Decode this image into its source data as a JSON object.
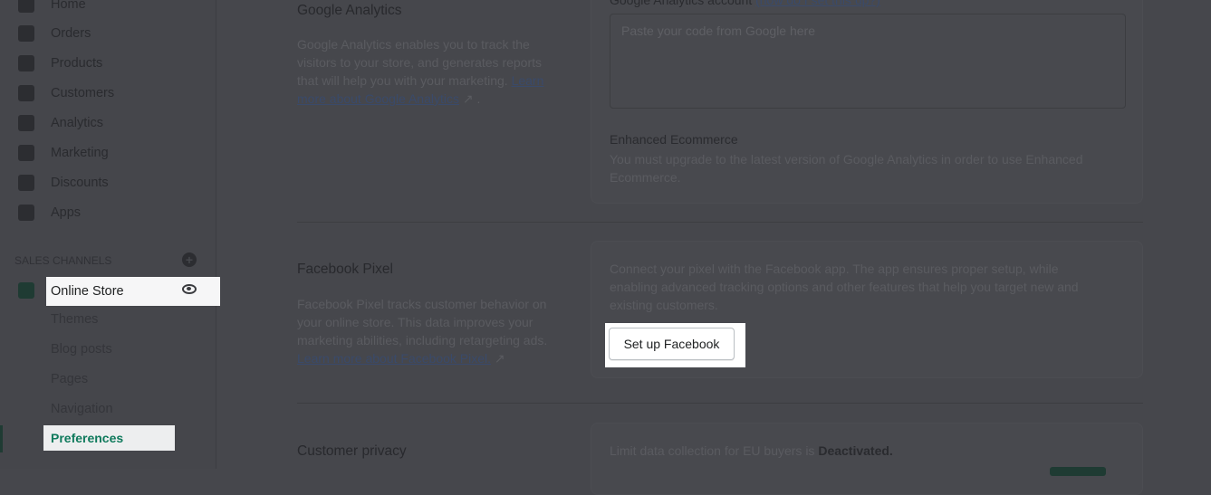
{
  "sidebar": {
    "items": [
      "Home",
      "Orders",
      "Products",
      "Customers",
      "Analytics",
      "Marketing",
      "Discounts",
      "Apps"
    ],
    "sales_channels": "SALES CHANNELS",
    "online_store": "Online Store",
    "sub_items": [
      "Themes",
      "Blog posts",
      "Pages",
      "Navigation"
    ],
    "active_sub": "Preferences"
  },
  "ga": {
    "title": "Google Analytics",
    "desc": "Google Analytics enables you to track the visitors to your store, and generates reports that will help you with your marketing.",
    "link": "Learn more about Google Analytics",
    "link_suffix": " .",
    "account_label": "Google Analytics account",
    "help_link": "(how do I set this up?)",
    "placeholder": "Paste your code from Google here",
    "ee_title": "Enhanced Ecommerce",
    "ee_desc": "You must upgrade to the latest version of Google Analytics in order to use Enhanced Ecommerce."
  },
  "fb": {
    "title": "Facebook Pixel",
    "desc": "Facebook Pixel tracks customer behavior on your online store. This data improves your marketing abilities, including retargeting ads.",
    "link": "Learn more about Facebook Pixel.",
    "card_text": "Connect your pixel with the Facebook app. The app ensures proper setup, while enabling advanced tracking options and other features that help you target new and existing customers.",
    "button": "Set up Facebook"
  },
  "privacy": {
    "title": "Customer privacy",
    "text": "Limit data collection for EU buyers is",
    "status": "Deactivated."
  },
  "colors": {
    "accent": "#008060",
    "overlay": "#46474c"
  }
}
